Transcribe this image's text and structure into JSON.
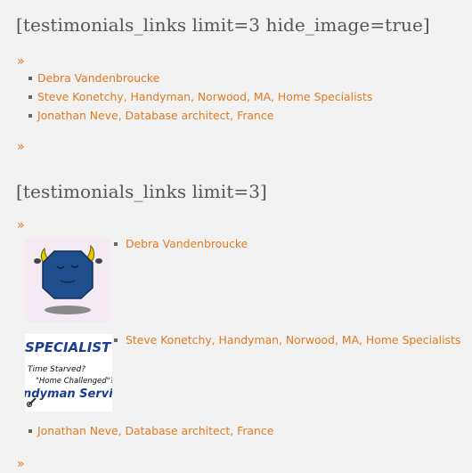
{
  "section1": {
    "heading": "[testimonials_links limit=3 hide_image=true]",
    "raquo_top": "»",
    "items": [
      "Debra Vandenbroucke",
      "Steve Konetchy, Handyman, Norwood, MA, Home Specialists",
      "Jonathan Neve, Database architect, France"
    ],
    "raquo_bottom": "»"
  },
  "section2": {
    "heading": "[testimonials_links limit=3]",
    "raquo_top": "»",
    "items": [
      "Debra Vandenbroucke",
      "Steve Konetchy, Handyman, Norwood, MA, Home Specialists",
      "Jonathan Neve, Database architect, France"
    ],
    "raquo_bottom": "»",
    "images": {
      "specialists_logo_text": {
        "line1": "SPECIALIST",
        "line2": "Time Starved?",
        "line3": "\"Home Challenged\"?",
        "line4": "ndyman Servi"
      }
    }
  },
  "colors": {
    "link": "#e07a1f",
    "heading": "#555555",
    "background": "#f2f2f2"
  }
}
